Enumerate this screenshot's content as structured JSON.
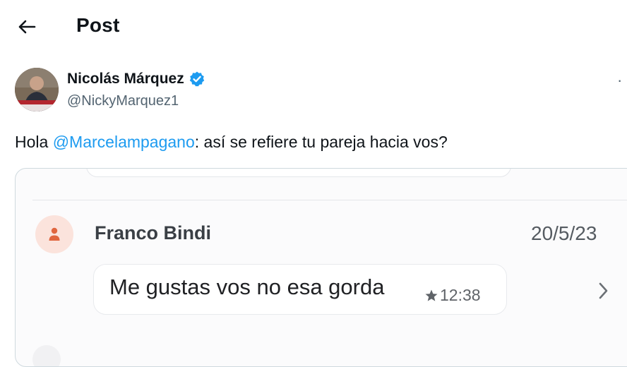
{
  "header": {
    "title": "Post",
    "back_icon": "arrow-left-icon"
  },
  "author": {
    "name": "Nicolás Márquez",
    "handle": "@NickyMarquez1",
    "verified_icon": "verified-badge-icon",
    "verified_color": "#1d9bf0"
  },
  "tweet": {
    "prefix": "Hola ",
    "mention": "@Marcelampagano",
    "suffix": ": así se refiere tu pareja hacia vos?",
    "mention_color": "#1d9bf0"
  },
  "media": {
    "sender_name": "Franco Bindi",
    "date": "20/5/23",
    "message": "Me gustas vos no esa gorda",
    "time": "12:38",
    "star_icon": "star-icon",
    "sender_avatar_icon": "person-icon",
    "sender_avatar_color": "#e0663f",
    "chevron_icon": "chevron-right-icon"
  }
}
